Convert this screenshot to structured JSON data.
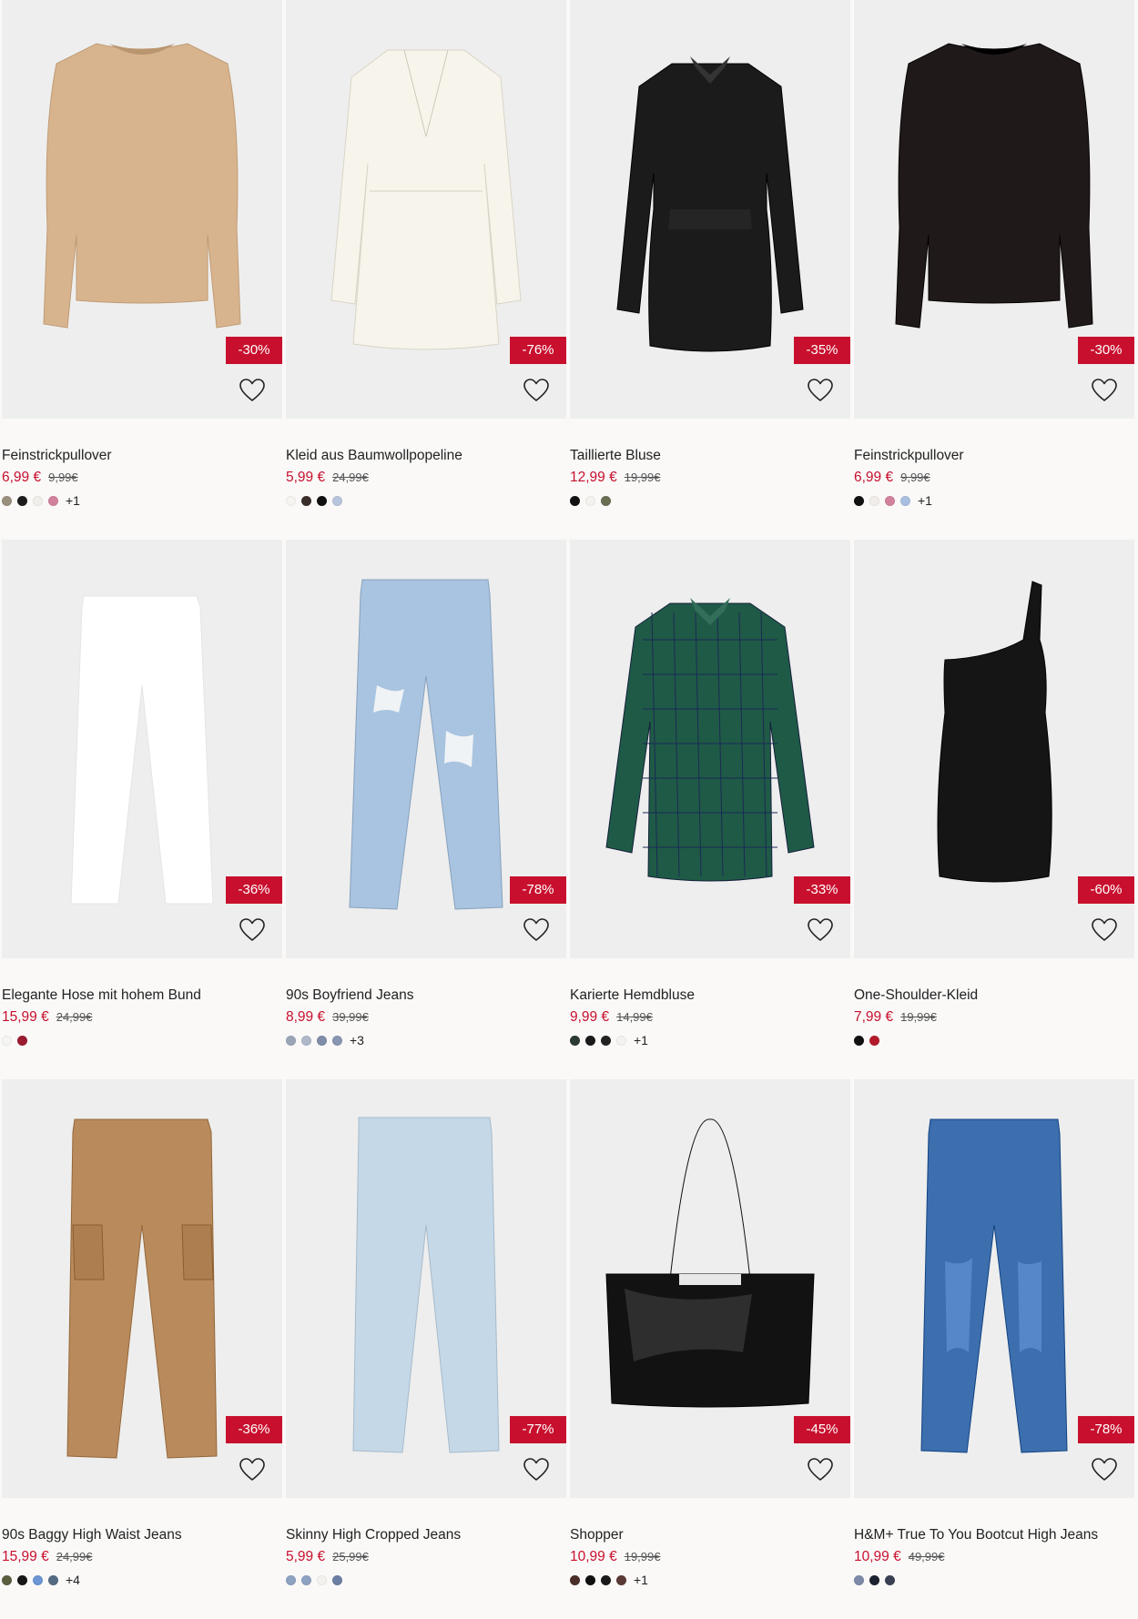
{
  "products": [
    {
      "title": "Feinstrickpullover",
      "price": "6,99 €",
      "old_price": "9,99€",
      "discount": "-30%",
      "garment": "sweater",
      "garment_color": "#d8b48e",
      "swatches": [
        "#9a8f7c",
        "#1c1c1c",
        "#f1efe9",
        "#d2819c"
      ],
      "more": "+1"
    },
    {
      "title": "Kleid aus Baumwollpopeline",
      "price": "5,99 €",
      "old_price": "24,99€",
      "discount": "-76%",
      "garment": "dress-long-sleeve",
      "garment_color": "#f7f4ec",
      "swatches": [
        "#f6f4ef",
        "#3a2e2a",
        "#111111",
        "#b8c3dc"
      ],
      "more": ""
    },
    {
      "title": "Taillierte Bluse",
      "price": "12,99 €",
      "old_price": "19,99€",
      "discount": "-35%",
      "garment": "blouse",
      "garment_color": "#1b1b1b",
      "swatches": [
        "#111111",
        "#f3f2ee",
        "#6a6e52"
      ],
      "more": ""
    },
    {
      "title": "Feinstrickpullover",
      "price": "6,99 €",
      "old_price": "9,99€",
      "discount": "-30%",
      "garment": "sweater",
      "garment_color": "#1f1a19",
      "swatches": [
        "#111111",
        "#f1ede8",
        "#d2819c",
        "#a9bfe0"
      ],
      "more": "+1"
    },
    {
      "title": "Elegante Hose mit hohem Bund",
      "price": "15,99 €",
      "old_price": "24,99€",
      "discount": "-36%",
      "garment": "trousers",
      "garment_color": "#ffffff",
      "swatches": [
        "#f5f5f3",
        "#9b1b30"
      ],
      "more": ""
    },
    {
      "title": "90s Boyfriend Jeans",
      "price": "8,99 €",
      "old_price": "39,99€",
      "discount": "-78%",
      "garment": "jeans",
      "garment_color": "#a9c4e0",
      "swatches": [
        "#9aa6b8",
        "#aeb8c8",
        "#7f8da8",
        "#8896b2"
      ],
      "more": "+3"
    },
    {
      "title": "Karierte Hemdbluse",
      "price": "9,99 €",
      "old_price": "14,99€",
      "discount": "-33%",
      "garment": "shirt-plaid",
      "garment_color": "#1f5a46",
      "swatches": [
        "#2b3a33",
        "#1a1a1a",
        "#222222",
        "#f3f2ee"
      ],
      "more": "+1"
    },
    {
      "title": "One-Shoulder-Kleid",
      "price": "7,99 €",
      "old_price": "19,99€",
      "discount": "-60%",
      "garment": "dress-one-shoulder",
      "garment_color": "#151515",
      "swatches": [
        "#111111",
        "#b31b2b"
      ],
      "more": ""
    },
    {
      "title": "90s Baggy High Waist Jeans",
      "price": "15,99 €",
      "old_price": "24,99€",
      "discount": "-36%",
      "garment": "cargo",
      "garment_color": "#b88a5c",
      "swatches": [
        "#5b5e3f",
        "#161616",
        "#6b95d3",
        "#556b82"
      ],
      "more": "+4"
    },
    {
      "title": "Skinny High Cropped Jeans",
      "price": "5,99 €",
      "old_price": "25,99€",
      "discount": "-77%",
      "garment": "jeans-light",
      "garment_color": "#c4d8e8",
      "swatches": [
        "#8ea2c2",
        "#8ea2c2",
        "#f3f2ee",
        "#6c7fa3"
      ],
      "more": ""
    },
    {
      "title": "Shopper",
      "price": "10,99 €",
      "old_price": "19,99€",
      "discount": "-45%",
      "garment": "bag",
      "garment_color": "#121212",
      "swatches": [
        "#4a2e28",
        "#111111",
        "#1a1a1a",
        "#5a3a34"
      ],
      "more": "+1"
    },
    {
      "title": "H&M+ True To You Bootcut High Jeans",
      "price": "10,99 €",
      "old_price": "49,99€",
      "discount": "-78%",
      "garment": "jeans-blue",
      "garment_color": "#3d6fae",
      "swatches": [
        "#7c8aa8",
        "#1c2230",
        "#3a4155"
      ],
      "more": ""
    }
  ]
}
